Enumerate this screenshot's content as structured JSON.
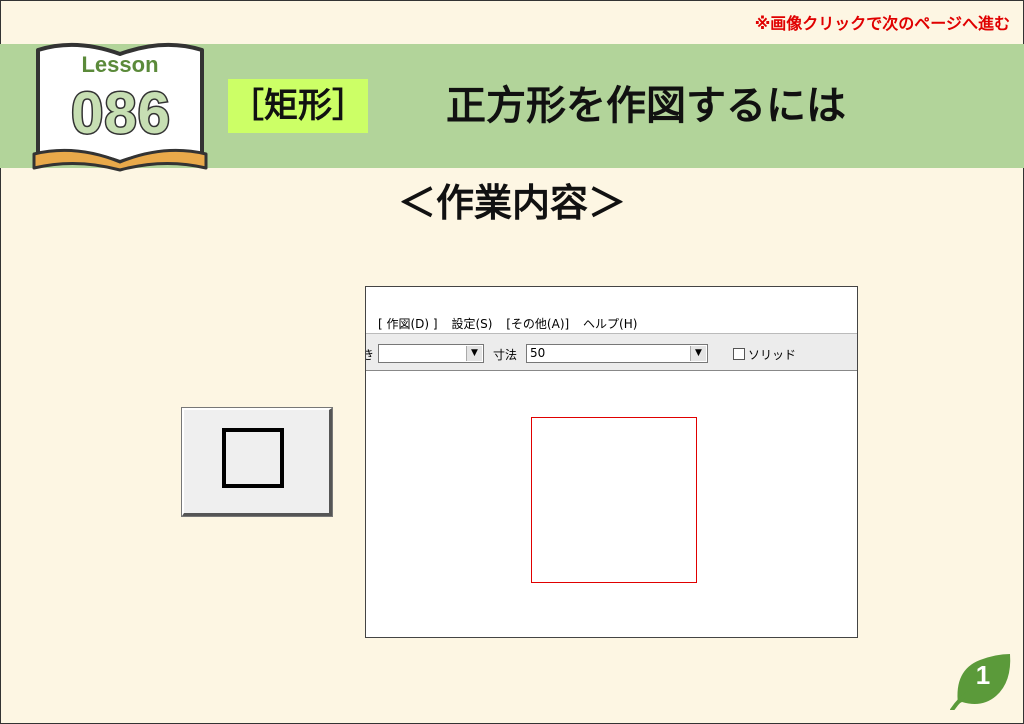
{
  "notice": "※画像クリックで次のページへ進む",
  "lesson": {
    "label": "Lesson",
    "number": "086"
  },
  "category": "［矩形］",
  "title": "正方形を作図するには",
  "subtitle": "＜作業内容＞",
  "app": {
    "menu": [
      "[ 作図(D) ]",
      "設定(S)",
      "[その他(A)]",
      "ヘルプ(H)"
    ],
    "toolbar": {
      "left_label": "き",
      "combo1_value": "",
      "dim_label": "寸法",
      "dim_value": "50",
      "solid_label": "ソリッド"
    }
  },
  "page_number": "1",
  "colors": {
    "banner": "#b2d49a",
    "tag": "#ccff66",
    "notice": "#e00000",
    "leaf": "#5b9a3a"
  }
}
